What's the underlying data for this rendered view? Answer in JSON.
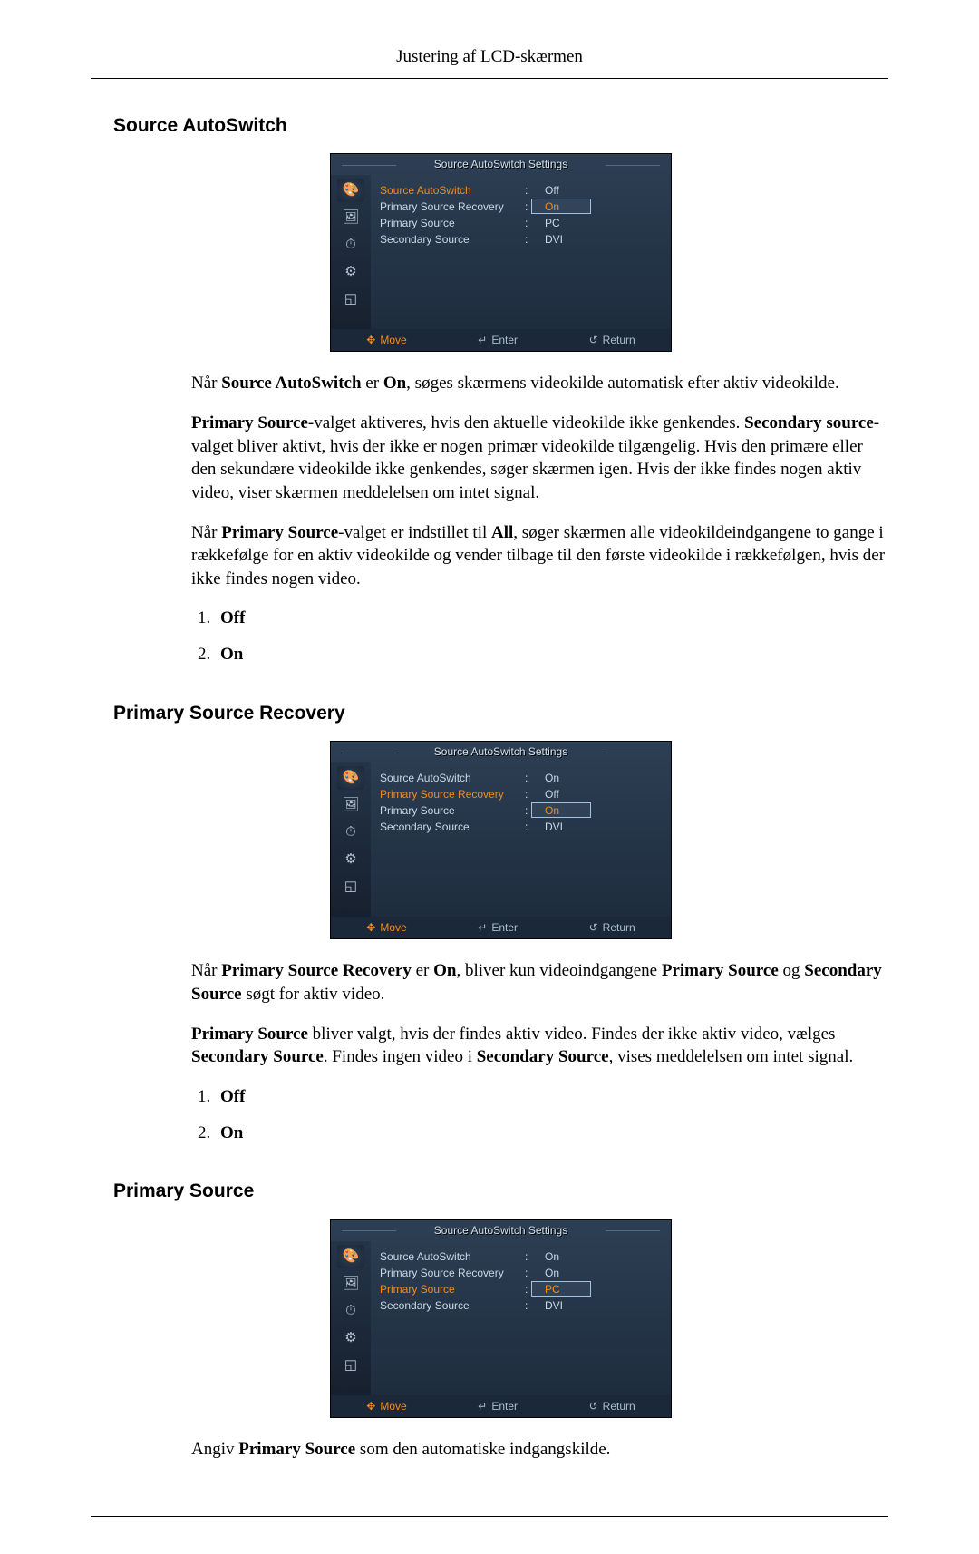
{
  "page_header": "Justering af LCD-skærmen",
  "sections": [
    {
      "title": "Source AutoSwitch",
      "osd": {
        "title": "Source AutoSwitch Settings",
        "rows": [
          {
            "label": "Source AutoSwitch",
            "value": "Off",
            "hl_label": true,
            "hl_value": false
          },
          {
            "label": "Primary Source Recovery",
            "value": "On",
            "hl_label": false,
            "hl_value": true,
            "cursor": true
          },
          {
            "label": "Primary Source",
            "value": "PC",
            "hl_label": false,
            "hl_value": false
          },
          {
            "label": "Secondary Source",
            "value": "DVI",
            "hl_label": false,
            "hl_value": false
          }
        ],
        "footer": {
          "move": "Move",
          "enter": "Enter",
          "return": "Return"
        }
      },
      "paras_html": [
        "Når <span class=\"b\">Source AutoSwitch</span> er <span class=\"b\">On</span>, søges skærmens videokilde automatisk efter aktiv videokilde.",
        "<span class=\"b\">Primary Source</span>-valget aktiveres, hvis den aktuelle videokilde ikke genkendes. <span class=\"b\">Secondary source</span>-valget bliver aktivt, hvis der ikke er nogen primær videokilde tilgængelig. Hvis den primære eller den sekundære videokilde ikke genkendes, søger skærmen igen. Hvis der ikke findes nogen aktiv video, viser skærmen meddelelsen om intet signal.",
        "Når <span class=\"b\">Primary Source</span>-valget er indstillet til <span class=\"b\">All</span>, søger skærmen alle videokildeindgangene to gange i rækkefølge for en aktiv videokilde og vender tilbage til den første videokilde i rækkefølgen, hvis der ikke findes nogen video."
      ],
      "options": [
        "Off",
        "On"
      ]
    },
    {
      "title": "Primary Source Recovery",
      "osd": {
        "title": "Source AutoSwitch Settings",
        "rows": [
          {
            "label": "Source AutoSwitch",
            "value": "On",
            "hl_label": false,
            "hl_value": false
          },
          {
            "label": "Primary Source Recovery",
            "value": "Off",
            "hl_label": true,
            "hl_value": false
          },
          {
            "label": "Primary Source",
            "value": "On",
            "hl_label": false,
            "hl_value": true,
            "cursor": true
          },
          {
            "label": "Secondary Source",
            "value": "DVI",
            "hl_label": false,
            "hl_value": false
          }
        ],
        "footer": {
          "move": "Move",
          "enter": "Enter",
          "return": "Return"
        }
      },
      "paras_html": [
        "Når <span class=\"b\">Primary Source Recovery</span> er <span class=\"b\">On</span>, bliver kun videoindgangene <span class=\"b\">Primary Source</span> og <span class=\"b\">Secondary Source</span> søgt for aktiv video.",
        "<span class=\"b\">Primary Source</span> bliver valgt, hvis der findes aktiv video. Findes der ikke aktiv video, vælges <span class=\"b\">Secondary Source</span>. Findes ingen video i <span class=\"b\">Secondary Source</span>, vises meddelelsen om intet signal."
      ],
      "options": [
        "Off",
        "On"
      ]
    },
    {
      "title": "Primary Source",
      "osd": {
        "title": "Source AutoSwitch Settings",
        "rows": [
          {
            "label": "Source AutoSwitch",
            "value": "On",
            "hl_label": false,
            "hl_value": false
          },
          {
            "label": "Primary Source Recovery",
            "value": "On",
            "hl_label": false,
            "hl_value": false
          },
          {
            "label": "Primary Source",
            "value": "PC",
            "hl_label": true,
            "hl_value": true,
            "cursor": true
          },
          {
            "label": "Secondary Source",
            "value": "DVI",
            "hl_label": false,
            "hl_value": false
          }
        ],
        "footer": {
          "move": "Move",
          "enter": "Enter",
          "return": "Return"
        }
      },
      "paras_html": [
        "Angiv <span class=\"b\">Primary Source</span> som den automatiske indgangskilde."
      ],
      "options": []
    }
  ],
  "icons": {
    "move_glyph": "✥",
    "enter_glyph": "↵",
    "return_glyph": "↺",
    "side_icons": [
      "palette-icon",
      "picture-icon",
      "timer-icon",
      "gear-icon",
      "pip-icon"
    ],
    "side_glyphs": [
      "🎨",
      "🖼",
      "⏱",
      "⚙",
      "◱"
    ]
  }
}
